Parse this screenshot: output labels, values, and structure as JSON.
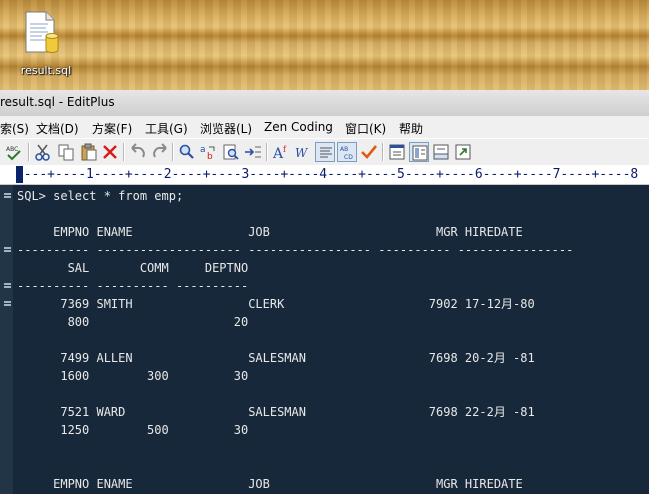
{
  "desktop": {
    "icon_label": "result.sql"
  },
  "window": {
    "title": "result.sql - EditPlus"
  },
  "menu": [
    {
      "label": "索(S)"
    },
    {
      "label": "文档(D)"
    },
    {
      "label": "方案(F)"
    },
    {
      "label": "工具(G)"
    },
    {
      "label": "浏览器(L)"
    },
    {
      "label": "Zen Coding"
    },
    {
      "label": "窗口(K)"
    },
    {
      "label": "帮助"
    }
  ],
  "toolbar": {
    "buttons": [
      {
        "icon": "spellcheck-icon"
      },
      {
        "icon": "cut-icon"
      },
      {
        "icon": "copy-icon"
      },
      {
        "icon": "paste-icon"
      },
      {
        "icon": "delete-icon"
      },
      {
        "icon": "undo-icon"
      },
      {
        "icon": "redo-icon"
      },
      {
        "icon": "find-icon"
      },
      {
        "icon": "replace-icon"
      },
      {
        "icon": "find-in-files-icon"
      },
      {
        "icon": "goto-line-icon"
      },
      {
        "icon": "font-icon"
      },
      {
        "icon": "word-wrap-icon"
      },
      {
        "icon": "line-number-icon"
      },
      {
        "icon": "ruler-icon"
      },
      {
        "icon": "check-icon"
      },
      {
        "icon": "window-list-icon"
      },
      {
        "icon": "output-window-icon"
      },
      {
        "icon": "directory-icon"
      },
      {
        "icon": "browser-icon"
      }
    ]
  },
  "ruler": {
    "text": "----+----1----+----2----+----3----+----4----+----5----+----6----+----7----+----8"
  },
  "editor": {
    "lines": [
      "SQL> select * from emp;",
      "",
      "     EMPNO ENAME                JOB                       MGR HIREDATE",
      "---------- -------------------- ----------------- ---------- ----------------",
      "       SAL       COMM     DEPTNO",
      "---------- ---------- ----------",
      "      7369 SMITH                CLERK                    7902 17-12月-80",
      "       800                    20",
      "",
      "      7499 ALLEN                SALESMAN                 7698 20-2月 -81",
      "      1600        300         30",
      "",
      "      7521 WARD                 SALESMAN                 7698 22-2月 -81",
      "      1250        500         30",
      "",
      "",
      "     EMPNO ENAME                JOB                       MGR HIREDATE"
    ]
  },
  "colors": {
    "editor_bg": "#17283a",
    "editor_text": "#e8e8e8"
  }
}
